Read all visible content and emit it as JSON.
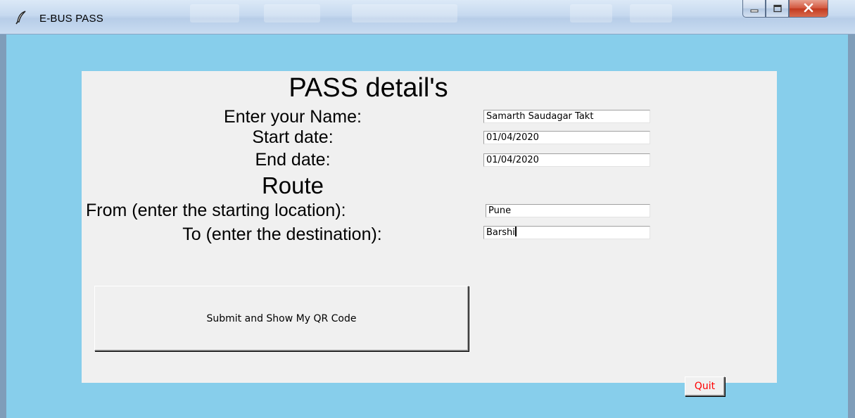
{
  "window": {
    "title": "E-BUS PASS"
  },
  "form": {
    "heading": "PASS detail's",
    "name_label": "Enter your Name:",
    "name_value": "Samarth Saudagar Takt",
    "start_label": "Start date:",
    "start_value": "01/04/2020",
    "end_label": "End date:",
    "end_value": "01/04/2020",
    "route_heading": "Route",
    "from_label": "From (enter the starting location):",
    "from_value": "Pune",
    "to_label": "To (enter the destination):",
    "to_value": "Barshi"
  },
  "buttons": {
    "submit_label": "Submit and Show My QR Code",
    "quit_label": "Quit"
  },
  "icons": {
    "app": "feather-icon",
    "minimize": "minimize-icon",
    "maximize": "maximize-icon",
    "close": "close-icon"
  },
  "colors": {
    "client_background": "#87ceeb",
    "panel_background": "#f0f0f0",
    "quit_text": "#ff0000"
  }
}
